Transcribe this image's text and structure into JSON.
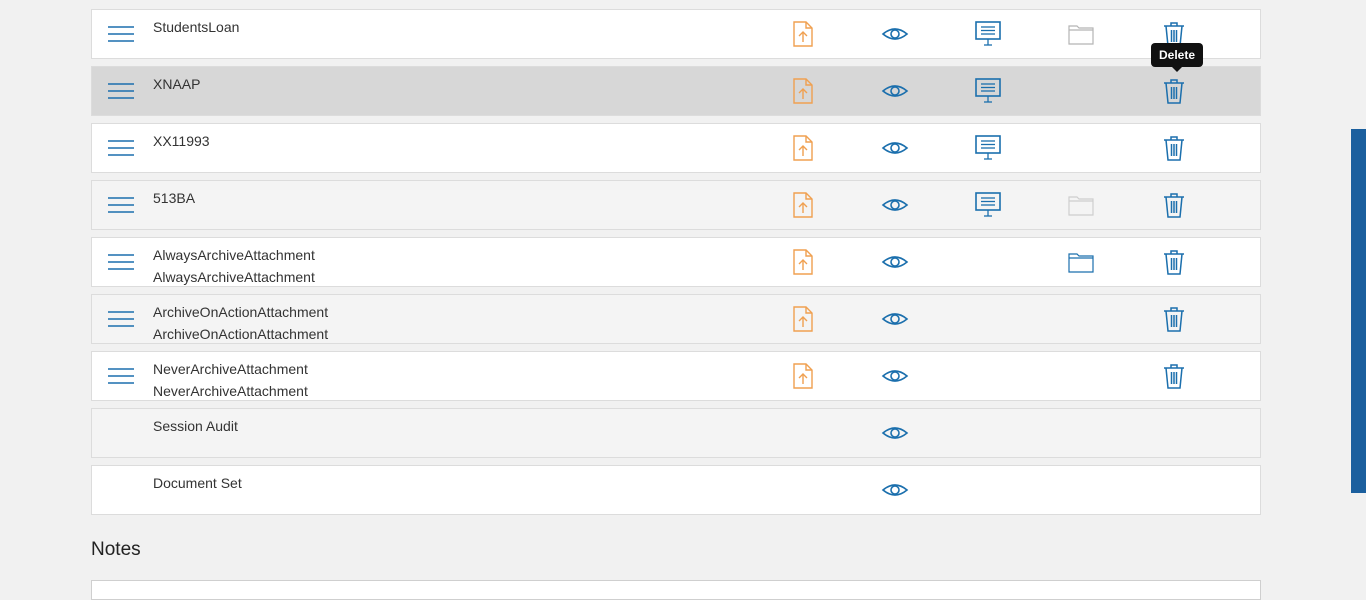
{
  "colors": {
    "accent_blue": "#1b6fad",
    "upload_orange": "#f0a050",
    "folder_gray": "#b5b5b5",
    "sidebar_blue": "#1b5f9e"
  },
  "icons": {
    "handle": "hamburger-menu-icon",
    "upload": "file-upload-icon",
    "view": "eye-icon",
    "present": "presentation-icon",
    "folder": "folder-icon",
    "delete": "trash-icon"
  },
  "rows": [
    {
      "names": [
        "StudentsLoan"
      ],
      "handle": true,
      "upload": true,
      "view": true,
      "present": true,
      "folder": true,
      "delete": true
    },
    {
      "names": [
        "XNAAP"
      ],
      "handle": true,
      "upload": true,
      "view": true,
      "present": true,
      "folder": false,
      "delete": true
    },
    {
      "names": [
        "XX11993"
      ],
      "handle": true,
      "upload": true,
      "view": true,
      "present": true,
      "folder": false,
      "delete": true
    },
    {
      "names": [
        "513BA"
      ],
      "handle": true,
      "upload": true,
      "view": true,
      "present": true,
      "folder": true,
      "delete": true
    },
    {
      "names": [
        "AlwaysArchiveAttachment",
        "AlwaysArchiveAttachment"
      ],
      "handle": true,
      "upload": true,
      "view": true,
      "present": false,
      "folder": true,
      "delete": true
    },
    {
      "names": [
        "ArchiveOnActionAttachment",
        "ArchiveOnActionAttachment"
      ],
      "handle": true,
      "upload": true,
      "view": true,
      "present": false,
      "folder": false,
      "delete": true
    },
    {
      "names": [
        "NeverArchiveAttachment",
        "NeverArchiveAttachment"
      ],
      "handle": true,
      "upload": true,
      "view": true,
      "present": false,
      "folder": false,
      "delete": true
    },
    {
      "names": [
        "Session Audit"
      ],
      "handle": false,
      "upload": false,
      "view": true,
      "present": false,
      "folder": false,
      "delete": false
    },
    {
      "names": [
        "Document Set"
      ],
      "handle": false,
      "upload": false,
      "view": true,
      "present": false,
      "folder": false,
      "delete": false
    }
  ],
  "tooltip": {
    "text": "Delete"
  },
  "notes": {
    "title": "Notes"
  }
}
